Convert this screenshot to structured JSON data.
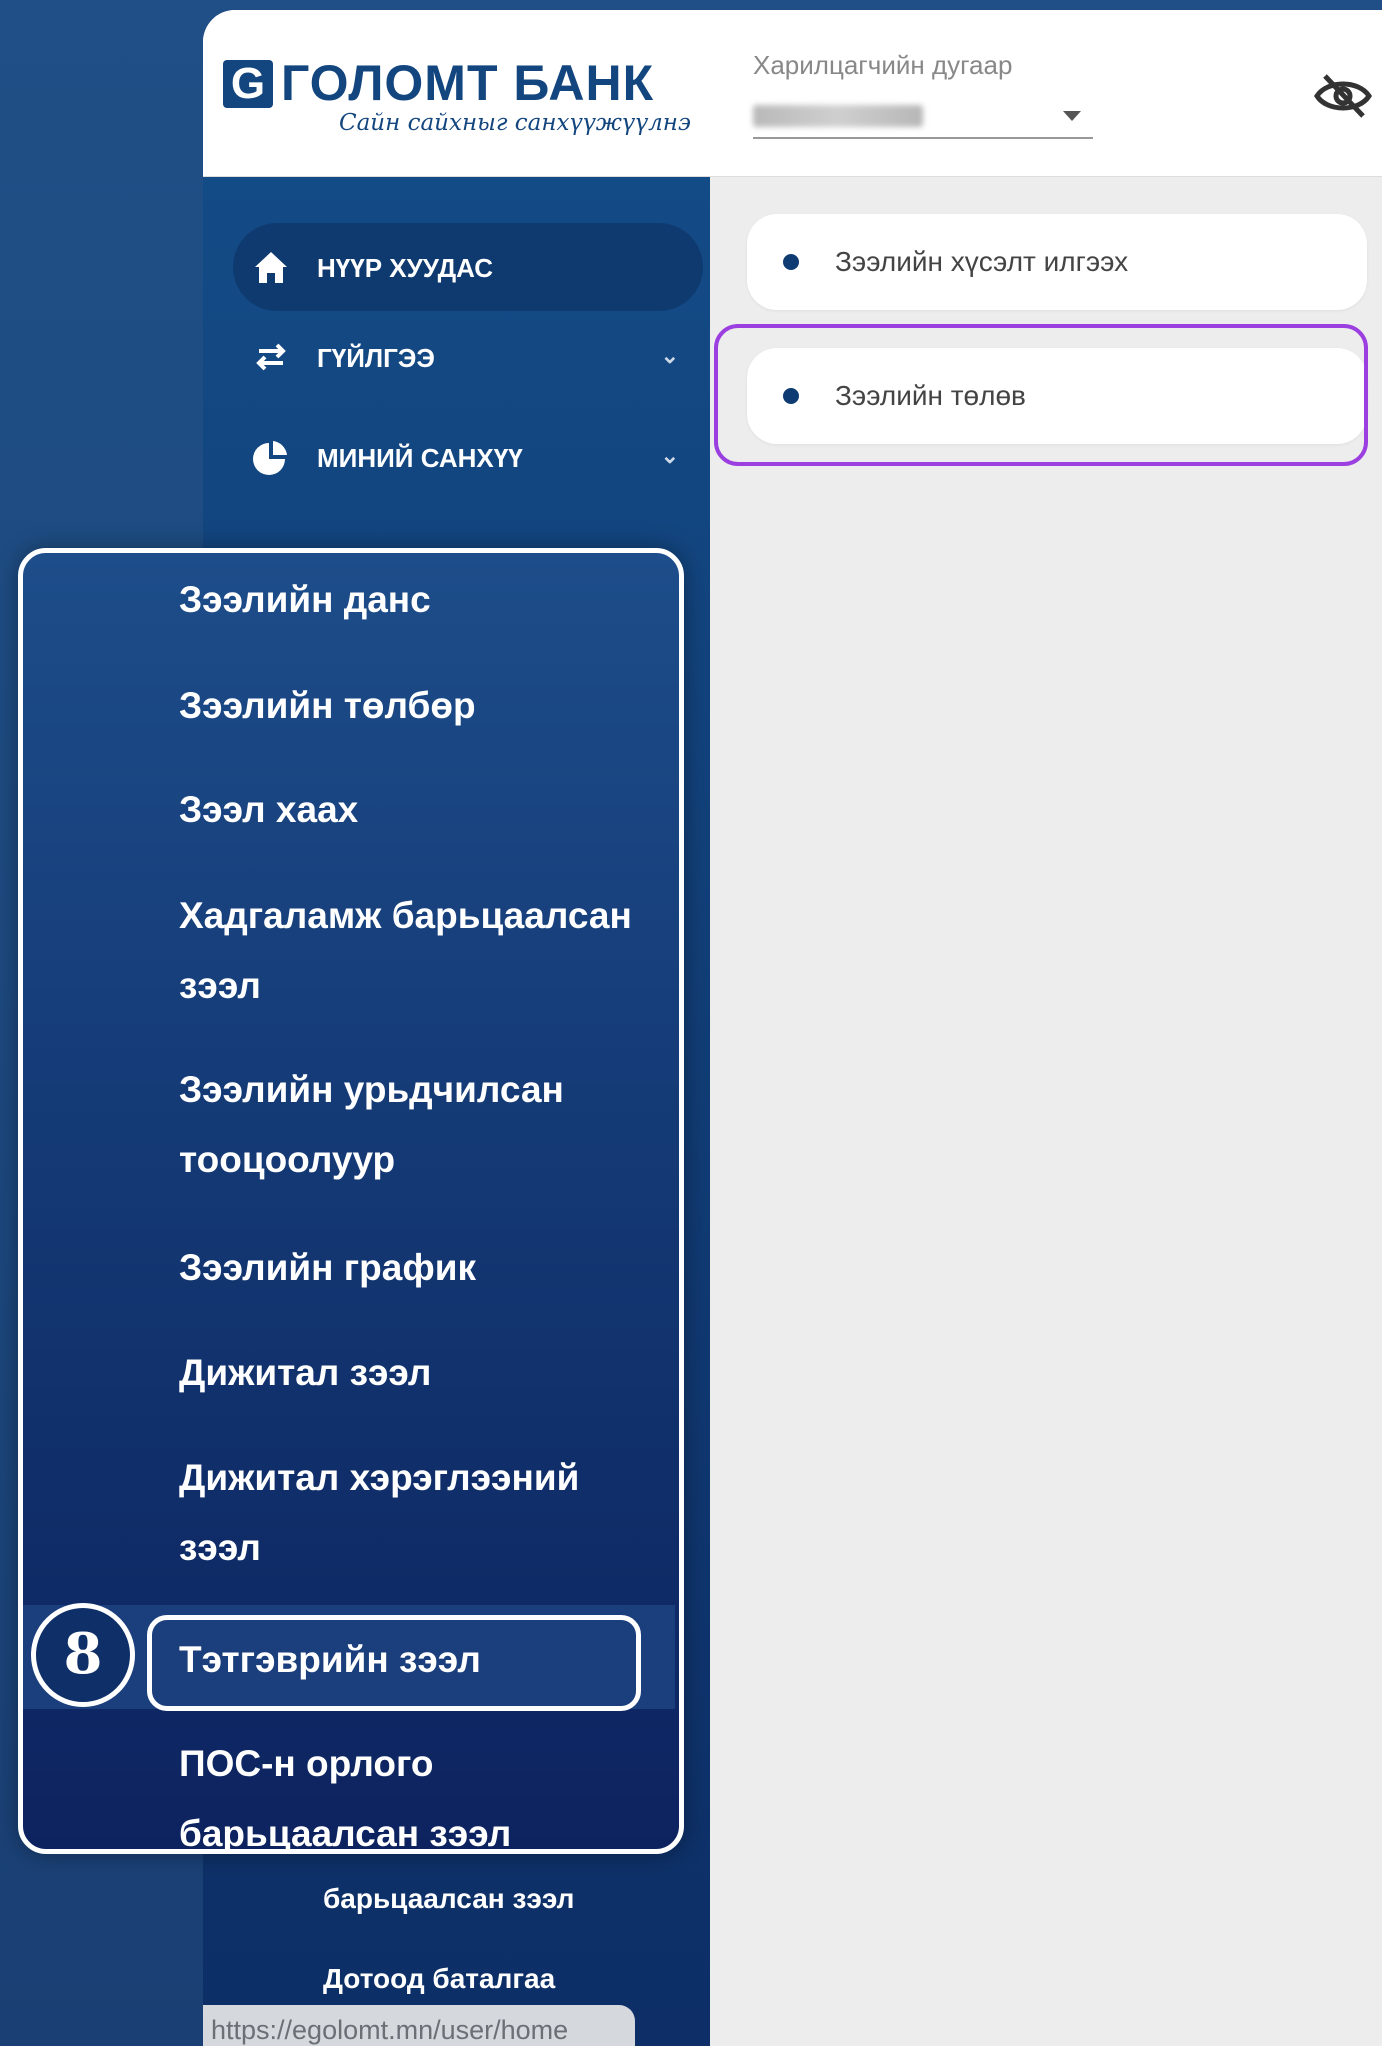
{
  "header": {
    "logo_letter": "G",
    "bank_name": "ГОЛОМТ БАНК",
    "slogan": "Сайн сайхныг санхүүжүүлнэ",
    "customer_label": "Харилцагчийн дугаар"
  },
  "sidebar": {
    "items": [
      {
        "label": "НҮҮР ХУУДАС",
        "icon": "home-icon"
      },
      {
        "label": "ГҮЙЛГЭЭ",
        "icon": "transfer-arrows-icon"
      },
      {
        "label": "МИНИЙ САНХҮҮ",
        "icon": "pie-chart-icon"
      }
    ],
    "bottom_items": [
      "барьцаалсан зээл",
      "Дотоод баталгаа"
    ],
    "url": "https://egolomt.mn/user/home"
  },
  "main": {
    "cards": [
      "Зээлийн хүсэлт илгээх",
      "Зээлийн төлөв"
    ]
  },
  "zoom": {
    "items": [
      "Зээлийн данс",
      "Зээлийн төлбөр",
      "Зээл хаах",
      "Хадгаламж барьцаалсан",
      "зээл",
      "Зээлийн урьдчилсан",
      "тооцоолуур",
      "Зээлийн график",
      "Дижитал зээл",
      "Дижитал хэрэглээний",
      "зээл",
      "Тэтгэврийн зээл",
      "ПОС-н орлого",
      "барьцаалсан зээл"
    ],
    "step_number": "8"
  },
  "colors": {
    "accent": "#13467f",
    "highlight": "#9b3fe0"
  }
}
